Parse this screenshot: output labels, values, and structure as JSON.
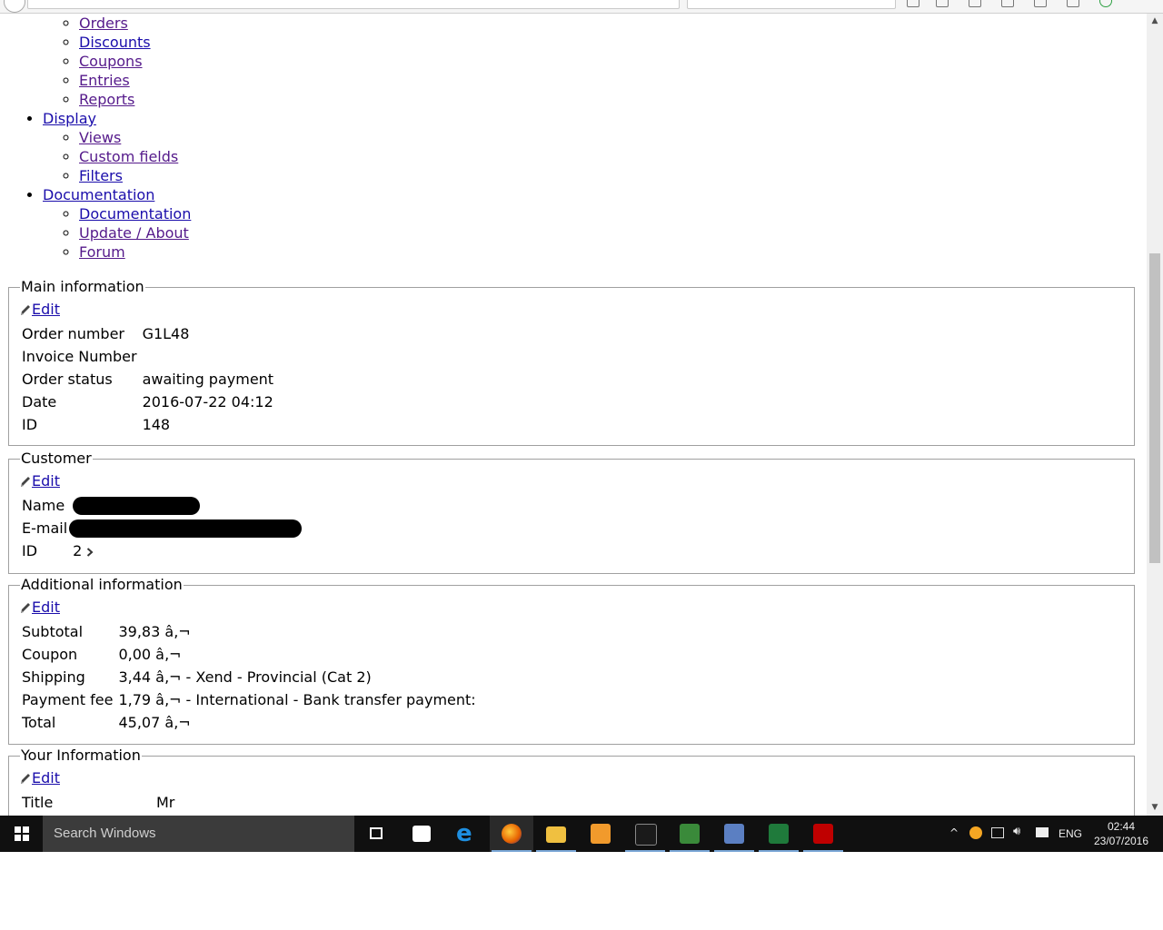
{
  "nav": {
    "top_sub": [
      "Orders",
      "Discounts",
      "Coupons",
      "Entries",
      "Reports"
    ],
    "sections": [
      {
        "label": "Display",
        "children": [
          "Views",
          "Custom fields",
          "Filters"
        ]
      },
      {
        "label": "Documentation",
        "children": [
          "Documentation",
          "Update / About",
          "Forum"
        ]
      }
    ]
  },
  "main_info": {
    "legend": "Main information",
    "edit": "Edit",
    "rows": [
      {
        "label": "Order number",
        "value": "G1L48"
      },
      {
        "label": "Invoice Number",
        "value": ""
      },
      {
        "label": "Order status",
        "value": "awaiting payment"
      },
      {
        "label": "Date",
        "value": "2016-07-22 04:12"
      },
      {
        "label": "ID",
        "value": "148"
      }
    ]
  },
  "customer": {
    "legend": "Customer",
    "edit": "Edit",
    "name_label": "Name",
    "email_label": "E-mail",
    "id_label": "ID",
    "id_value": "2"
  },
  "additional": {
    "legend": "Additional information",
    "edit": "Edit",
    "rows": [
      {
        "label": "Subtotal",
        "value": "39,83 â‚¬"
      },
      {
        "label": "Coupon",
        "value": "0,00 â‚¬"
      },
      {
        "label": "Shipping",
        "value": "3,44 â‚¬ - Xend - Provincial (Cat 2)"
      },
      {
        "label": "Payment fee",
        "value": "1,79 â‚¬ - International - Bank transfer payment:"
      },
      {
        "label": "Total",
        "value": "45,07 â‚¬"
      }
    ]
  },
  "your_info": {
    "legend": "Your Information",
    "edit": "Edit",
    "rows": [
      {
        "label": "Title",
        "value": "Mr"
      }
    ]
  },
  "taskbar": {
    "search_placeholder": "Search Windows",
    "language": "ENG",
    "time": "02:44",
    "date": "23/07/2016"
  }
}
